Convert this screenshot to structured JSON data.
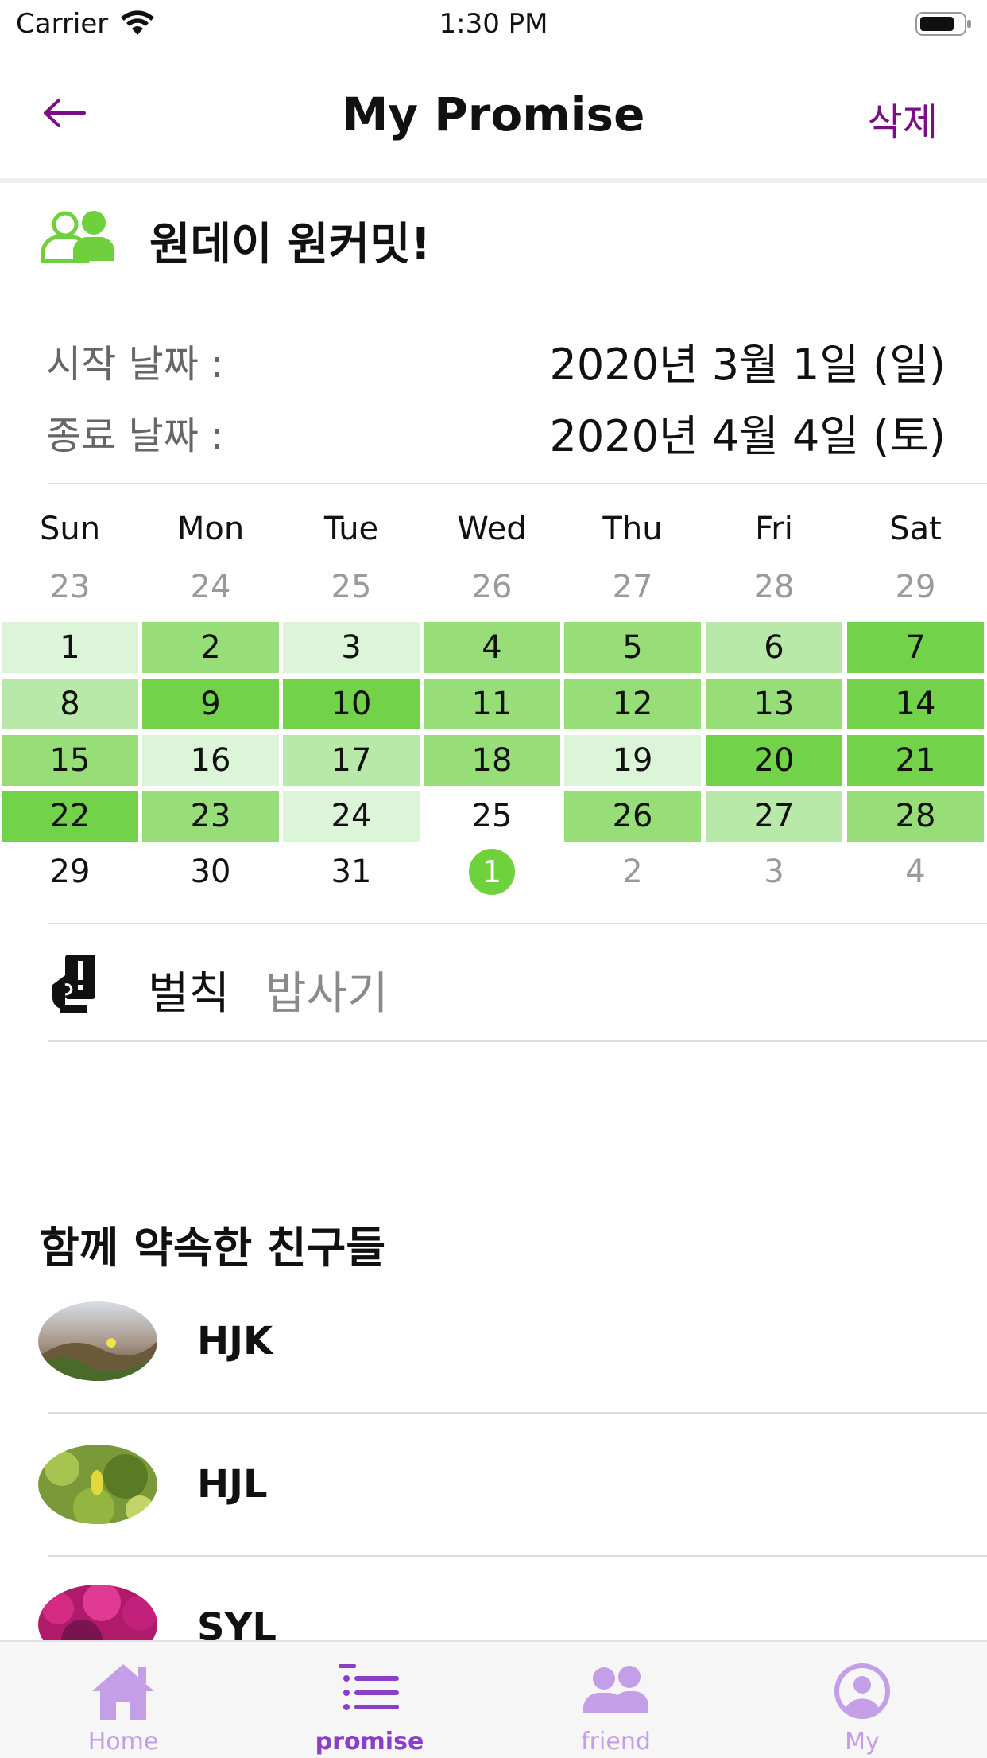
{
  "status_bar": {
    "carrier": "Carrier",
    "time": "1:30 PM"
  },
  "nav": {
    "title": "My Promise",
    "delete_label": "삭제"
  },
  "promise": {
    "title": "원데이 원커밋!",
    "start_label": "시작 날짜 :",
    "start_value": "2020년 3월 1일 (일)",
    "end_label": "종료 날짜 :",
    "end_value": "2020년 4월 4일 (토)"
  },
  "calendar": {
    "weekdays": [
      "Sun",
      "Mon",
      "Tue",
      "Wed",
      "Thu",
      "Fri",
      "Sat"
    ],
    "rows": [
      [
        {
          "d": "23",
          "s": "gray"
        },
        {
          "d": "24",
          "s": "gray"
        },
        {
          "d": "25",
          "s": "gray"
        },
        {
          "d": "26",
          "s": "gray"
        },
        {
          "d": "27",
          "s": "gray"
        },
        {
          "d": "28",
          "s": "gray"
        },
        {
          "d": "29",
          "s": "gray"
        }
      ],
      [
        {
          "d": "1",
          "s": "l1"
        },
        {
          "d": "2",
          "s": "l3"
        },
        {
          "d": "3",
          "s": "l1"
        },
        {
          "d": "4",
          "s": "l3"
        },
        {
          "d": "5",
          "s": "l3"
        },
        {
          "d": "6",
          "s": "l2"
        },
        {
          "d": "7",
          "s": "l4"
        }
      ],
      [
        {
          "d": "8",
          "s": "l2"
        },
        {
          "d": "9",
          "s": "l4"
        },
        {
          "d": "10",
          "s": "l4"
        },
        {
          "d": "11",
          "s": "l3"
        },
        {
          "d": "12",
          "s": "l3"
        },
        {
          "d": "13",
          "s": "l3"
        },
        {
          "d": "14",
          "s": "l4"
        }
      ],
      [
        {
          "d": "15",
          "s": "l3"
        },
        {
          "d": "16",
          "s": "l1"
        },
        {
          "d": "17",
          "s": "l2"
        },
        {
          "d": "18",
          "s": "l3"
        },
        {
          "d": "19",
          "s": "l1"
        },
        {
          "d": "20",
          "s": "l4"
        },
        {
          "d": "21",
          "s": "l4"
        }
      ],
      [
        {
          "d": "22",
          "s": "l4"
        },
        {
          "d": "23",
          "s": "l3"
        },
        {
          "d": "24",
          "s": "l1"
        },
        {
          "d": "25",
          "s": "none"
        },
        {
          "d": "26",
          "s": "l3"
        },
        {
          "d": "27",
          "s": "l2"
        },
        {
          "d": "28",
          "s": "l3"
        }
      ],
      [
        {
          "d": "29",
          "s": "none"
        },
        {
          "d": "30",
          "s": "none"
        },
        {
          "d": "31",
          "s": "none"
        },
        {
          "d": "1",
          "s": "today"
        },
        {
          "d": "2",
          "s": "gray"
        },
        {
          "d": "3",
          "s": "gray"
        },
        {
          "d": "4",
          "s": "gray"
        }
      ]
    ]
  },
  "penalty": {
    "label": "벌칙",
    "value": "밥사기"
  },
  "friends": {
    "heading": "함께 약속한 친구들",
    "items": [
      {
        "name": "HJK"
      },
      {
        "name": "HJL"
      },
      {
        "name": "SYL"
      }
    ]
  },
  "tabs": [
    {
      "label": "Home",
      "icon": "home-icon"
    },
    {
      "label": "promise",
      "icon": "list-icon"
    },
    {
      "label": "friend",
      "icon": "people-icon"
    },
    {
      "label": "My",
      "icon": "person-circle-icon"
    }
  ],
  "colors": {
    "accent_purple": "#7a0f85",
    "tab_active": "#8b3fc6",
    "tab_inactive": "#c49ee6",
    "green_1": "#dcf4d7",
    "green_2": "#b9e9a9",
    "green_3": "#97dd78",
    "green_4": "#72d24a",
    "today": "#6fd23c"
  }
}
